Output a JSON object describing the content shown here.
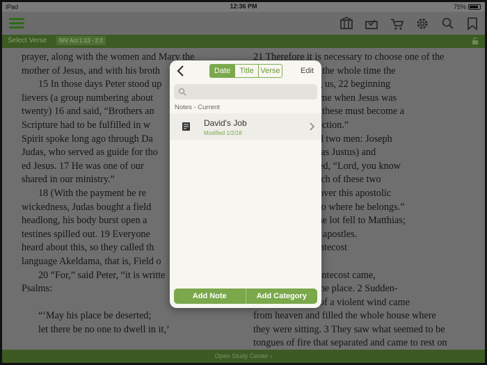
{
  "status_bar": {
    "carrier": "iPad",
    "time": "12:36 PM",
    "battery": "75%"
  },
  "verse_bar": {
    "label": "Select Verse",
    "reference": "NIV Act 1:13 - 2:3"
  },
  "bottom_bar": {
    "label": "Open Study Center"
  },
  "left_column": [
    "prayer, along with the women and Mary the",
    "mother of Jesus, and with his broth",
    "15 In those days Peter stood up",
    "lievers (a group numbering about",
    "twenty) 16 and said, “Brothers an",
    "Scripture had to be fulfilled in w",
    "Spirit spoke long ago through Da",
    "Judas, who served as guide for tho",
    "ed Jesus. 17 He was one of our",
    "shared in our ministry.”",
    "18 (With the payment he re",
    "wickedness, Judas bought a field",
    "headlong, his body burst open a",
    "testines spilled out. 19 Everyone",
    "heard about this, so they called th",
    "language Akeldama, that is, Field o",
    "20 “For,” said Peter, “it is writte",
    "Psalms:",
    "",
    "“‘May his place be deserted;",
    "let there be no one to dwell in it,’",
    "",
    "and,"
  ],
  "right_column": [
    "21 Therefore it is necessary to choose one of the",
    "been with us the whole time the",
    "living among us, 22 beginning",
    "tism to the time when Jesus was",
    "s. For one of these must become a",
    "of his resurrection.”",
    "ey nominated two men: Joseph",
    "(also known as Justus) and",
    "en they prayed, “Lord, you know",
    "Show us which of these two",
    "n 25 to take over this apostolic",
    "udas left to go where he belongs.”",
    "st lots, and the lot fell to Matthias;",
    "to the eleven apostles.",
    "Comes at Pentecost",
    "",
    "the day of Pentecost came,",
    "together in one place. 2 Sudden-",
    "the blowing of a violent wind came",
    "from heaven and filled the whole house where",
    "they were sitting. 3 They saw what seemed to be",
    "tongues of fire that separated and came to rest on"
  ],
  "popup": {
    "tabs": [
      "Date",
      "Title",
      "Verse"
    ],
    "active_tab": "Date",
    "edit_label": "Edit",
    "search_placeholder": "",
    "section_title": "Notes - Current",
    "notes": [
      {
        "title": "David's Job",
        "modified": "Modified 1/2/18"
      }
    ],
    "add_note_label": "Add Note",
    "add_category_label": "Add Category"
  },
  "colors": {
    "accent": "#7aa84b",
    "bar": "#3c5a23"
  }
}
